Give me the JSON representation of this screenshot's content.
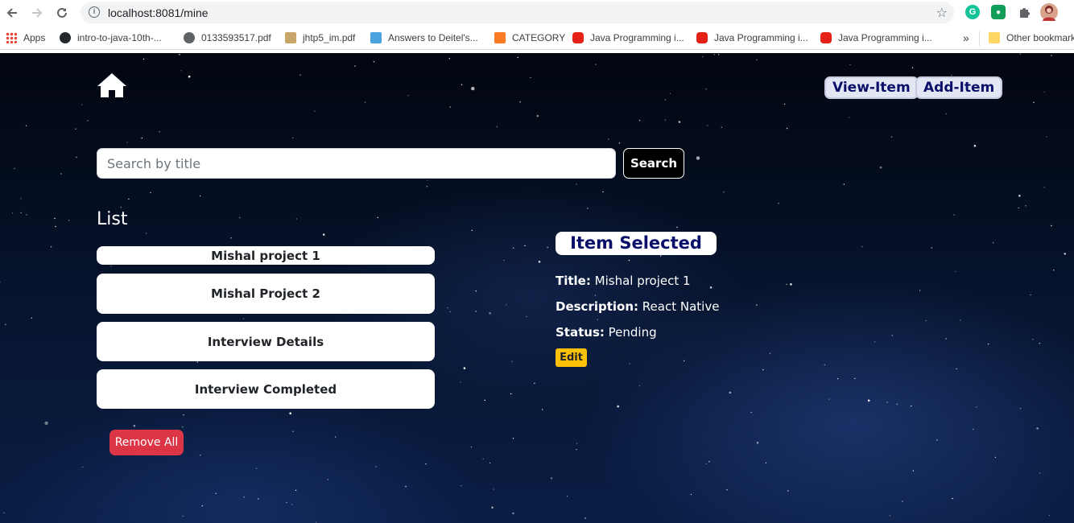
{
  "browser": {
    "url": "localhost:8081/mine",
    "bookmarks": [
      {
        "label": "Apps",
        "icon": "apps-grid-icon"
      },
      {
        "label": "intro-to-java-10th-...",
        "icon": "github-icon"
      },
      {
        "label": "0133593517.pdf",
        "icon": "globe-icon"
      },
      {
        "label": "jhtp5_im.pdf",
        "icon": "document-icon"
      },
      {
        "label": "Answers to Deitel's...",
        "icon": "answers-icon"
      },
      {
        "label": "CATEGORY",
        "icon": "category-icon"
      },
      {
        "label": "Java Programming i...",
        "icon": "youtube-icon"
      },
      {
        "label": "Java Programming i...",
        "icon": "youtube-icon"
      },
      {
        "label": "Java Programming i...",
        "icon": "youtube-icon"
      }
    ],
    "overflow": "»",
    "other_bookmarks": "Other bookmarks"
  },
  "header": {
    "view_item": "View-Item",
    "add_item": "Add-Item"
  },
  "search": {
    "placeholder": "Search by title",
    "button": "Search"
  },
  "list": {
    "title": "List",
    "items": [
      "Mishal project 1",
      "Mishal Project 2",
      "Interview Details",
      "Interview Completed"
    ],
    "remove_all": "Remove All"
  },
  "selected": {
    "heading": "Item Selected",
    "title_label": "Title:",
    "title_value": "Mishal project 1",
    "description_label": "Description:",
    "description_value": "React Native",
    "status_label": "Status:",
    "status_value": "Pending",
    "edit": "Edit"
  },
  "colors": {
    "accent_navy": "#0a0f6a",
    "danger": "#dc3545",
    "warning": "#ffc107"
  }
}
